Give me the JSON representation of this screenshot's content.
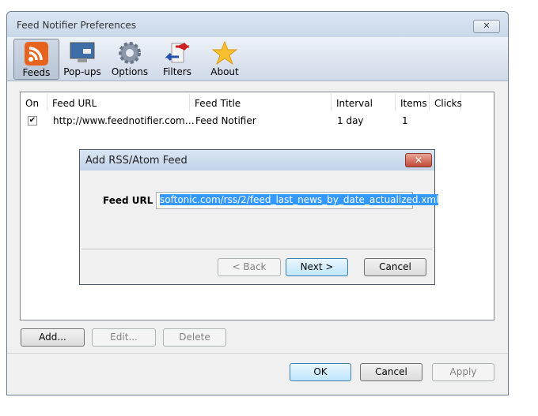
{
  "window": {
    "title": "Feed Notifier Preferences",
    "close": "✕"
  },
  "toolbar": [
    {
      "label": "Feeds",
      "icon": "rss-icon",
      "selected": true
    },
    {
      "label": "Pop-ups",
      "icon": "monitor-icon"
    },
    {
      "label": "Options",
      "icon": "gear-icon"
    },
    {
      "label": "Filters",
      "icon": "filter-arrows-icon"
    },
    {
      "label": "About",
      "icon": "star-icon"
    }
  ],
  "table": {
    "headers": [
      "On",
      "Feed URL",
      "Feed Title",
      "Interval",
      "Items",
      "Clicks"
    ],
    "rows": [
      {
        "on": true,
        "check": "✔",
        "url": "http://www.feednotifier.com…",
        "title": "Feed Notifier",
        "interval": "1 day",
        "items": "1",
        "clicks": ""
      }
    ]
  },
  "list_buttons": {
    "add": "Add...",
    "edit": "Edit...",
    "delete": "Delete"
  },
  "footer": {
    "ok": "OK",
    "cancel": "Cancel",
    "apply": "Apply"
  },
  "dialog": {
    "title": "Add RSS/Atom Feed",
    "close": "✕",
    "label": "Feed URL",
    "value": "softonic.com/rss/2/feed_last_news_by_date_actualized.xml",
    "back": "< Back",
    "next": "Next >",
    "cancel": "Cancel"
  }
}
